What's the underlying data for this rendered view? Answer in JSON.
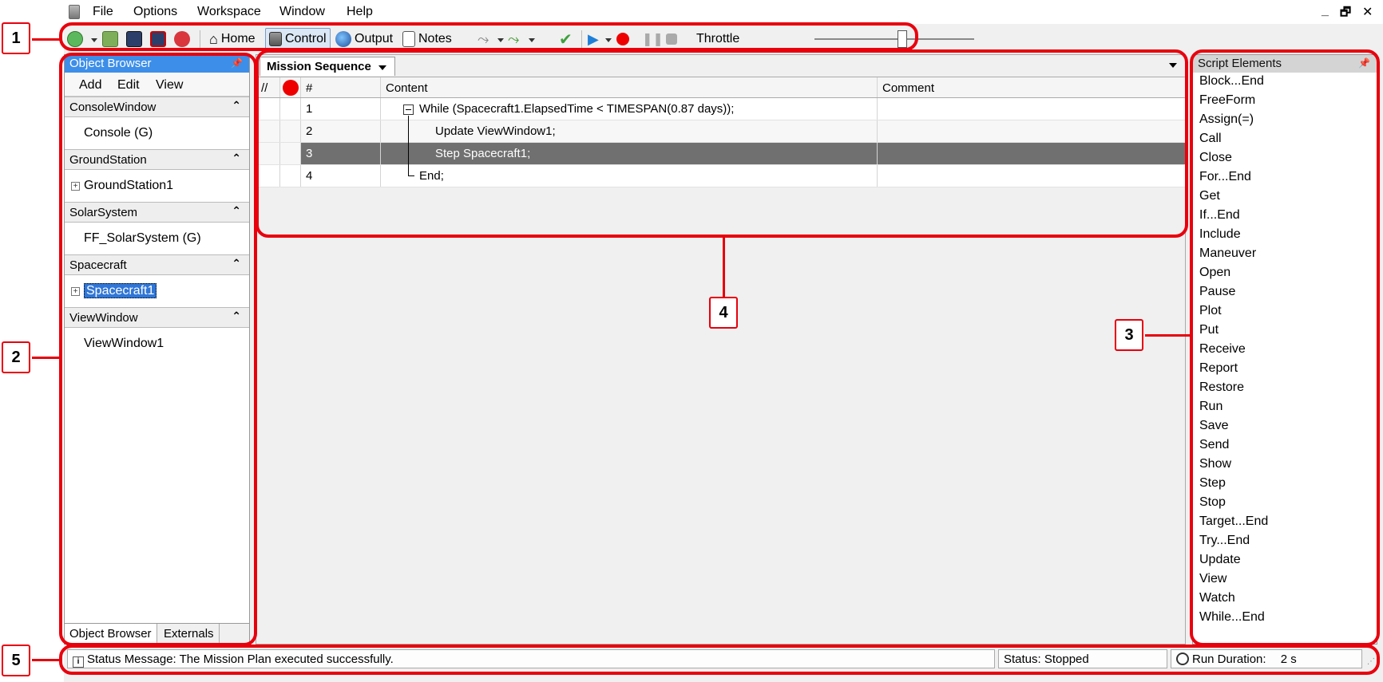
{
  "menubar": {
    "items": [
      "File",
      "Options",
      "Workspace",
      "Window",
      "Help"
    ],
    "minimize": "_",
    "restore": "🗗",
    "close": "✕"
  },
  "toolbar": {
    "home": "Home",
    "control": "Control",
    "output": "Output",
    "notes": "Notes",
    "throttle": "Throttle"
  },
  "object_browser": {
    "title": "Object Browser",
    "menu": [
      "Add",
      "Edit",
      "View"
    ],
    "sections": [
      {
        "header": "ConsoleWindow",
        "item": "Console (G)"
      },
      {
        "header": "GroundStation",
        "item": "GroundStation1"
      },
      {
        "header": "SolarSystem",
        "item": "FF_SolarSystem (G)"
      },
      {
        "header": "Spacecraft",
        "item": "Spacecraft1"
      },
      {
        "header": "ViewWindow",
        "item": "ViewWindow1"
      }
    ],
    "tabs": [
      "Object Browser",
      "Externals"
    ]
  },
  "mission": {
    "tab": "Mission Sequence",
    "columns": {
      "comment": "//",
      "number": "#",
      "content": "Content",
      "remark": "Comment"
    },
    "rows": [
      {
        "num": "1",
        "content": "While (Spacecraft1.ElapsedTime < TIMESPAN(0.87 days));"
      },
      {
        "num": "2",
        "content": "Update ViewWindow1;"
      },
      {
        "num": "3",
        "content": "Step Spacecraft1;"
      },
      {
        "num": "4",
        "content": "End;"
      }
    ]
  },
  "script_elements": {
    "title": "Script Elements",
    "items": [
      "Block...End",
      "FreeForm",
      "Assign(=)",
      "Call",
      "Close",
      "For...End",
      "Get",
      "If...End",
      "Include",
      "Maneuver",
      "Open",
      "Pause",
      "Plot",
      "Put",
      "Receive",
      "Report",
      "Restore",
      "Run",
      "Save",
      "Send",
      "Show",
      "Step",
      "Stop",
      "Target...End",
      "Try...End",
      "Update",
      "View",
      "Watch",
      "While...End"
    ]
  },
  "statusbar": {
    "message": "Status Message: The Mission Plan executed successfully.",
    "status": "Status: Stopped",
    "duration_label": "Run Duration:",
    "duration_value": "2 s"
  },
  "annotations": [
    "1",
    "2",
    "3",
    "4",
    "5"
  ],
  "colors": {
    "annotation": "#e8000d",
    "selection": "#3076d6",
    "breakpoint": "#e00000"
  }
}
